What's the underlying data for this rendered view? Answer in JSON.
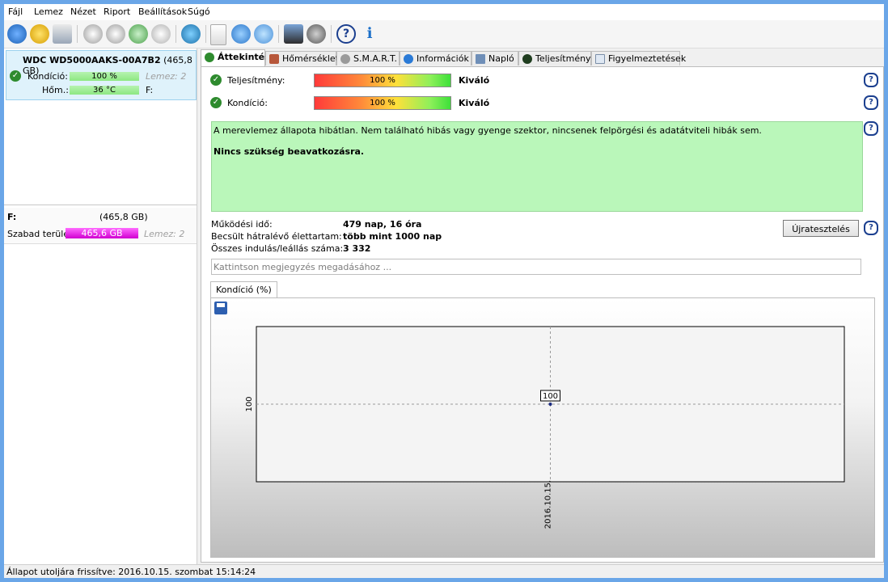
{
  "menu": [
    "Fájl",
    "Lemez",
    "Nézet",
    "Riport",
    "Beállítások",
    "Súgó"
  ],
  "left": {
    "disk_model": "WDC WD5000AAKS-00A7B2",
    "disk_size": "(465,8 GB)",
    "condition_label": "Kondíció:",
    "condition_value": "100 %",
    "disk_index_label": "Lemez: 2",
    "temp_label": "Hőm.:",
    "temp_value": "36 °C",
    "drive_letter_label": "F:",
    "volume_letter": "F:",
    "volume_size": "(465,8 GB)",
    "free_label": "Szabad terület",
    "free_value": "465,6 GB",
    "free_percent": 100,
    "volume_disk_label": "Lemez: 2"
  },
  "tabs": [
    "Áttekintés",
    "Hőmérséklet",
    "S.M.A.R.T.",
    "Információk",
    "Napló",
    "Teljesítmény",
    "Figyelmeztetések"
  ],
  "overview": {
    "performance_label": "Teljesítmény:",
    "performance_value": "100 %",
    "performance_percent": 100,
    "performance_rating": "Kiváló",
    "condition_label": "Kondíció:",
    "condition_value": "100 %",
    "condition_percent": 100,
    "condition_rating": "Kiváló",
    "status_text": "A merevlemez állapota hibátlan. Nem található hibás vagy gyenge szektor, nincsenek felpörgési és adatátviteli hibák sem.",
    "action_text": "Nincs szükség beavatkozásra.",
    "power_on_label": "Működési idő:",
    "power_on_value": "479 nap, 16 óra",
    "lifetime_label": "Becsült hátralévő élettartam:",
    "lifetime_value": "több mint 1000 nap",
    "start_stop_label": "Összes indulás/leállás száma:",
    "start_stop_value": "3 332",
    "retest_button": "Újratesztelés",
    "note_placeholder": "Kattintson megjegyzés megadásához ..."
  },
  "chart_tab": "Kondíció  (%)",
  "chart_data": {
    "type": "line",
    "x": [
      "2016.10.15."
    ],
    "series": [
      {
        "values": [
          100
        ]
      }
    ],
    "data_labels": [
      "100"
    ],
    "y_tick_labels": [
      "100"
    ],
    "x_tick_labels": [
      "2016.10.15."
    ],
    "grid": true
  },
  "status_bar": "Állapot utoljára frissítve: 2016.10.15. szombat 15:14:24"
}
